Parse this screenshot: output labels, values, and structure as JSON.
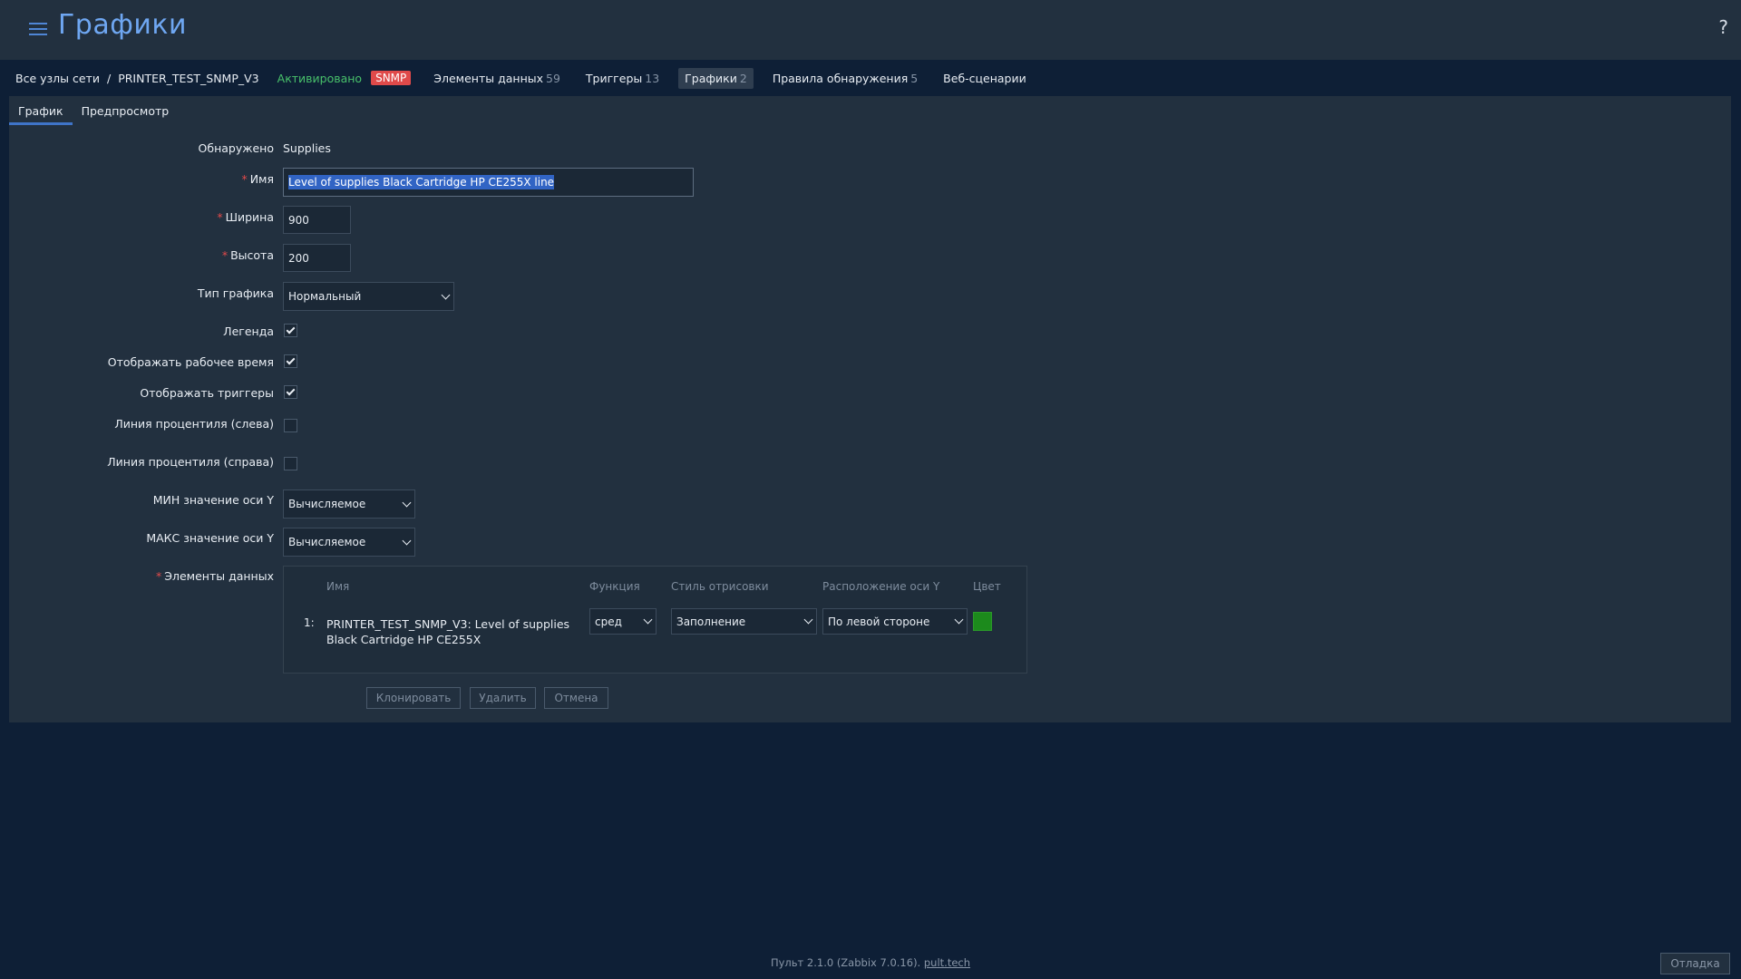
{
  "header": {
    "title": "Графики",
    "help": "?"
  },
  "hostnav": {
    "all_hosts": "Все узлы сети",
    "separator": "/",
    "host": "PRINTER_TEST_SNMP_V3",
    "status": "Активировано",
    "badge": "SNMP",
    "links": [
      {
        "label": "Элементы данных",
        "count": "59"
      },
      {
        "label": "Триггеры",
        "count": "13"
      },
      {
        "label": "Графики",
        "count": "2"
      },
      {
        "label": "Правила обнаружения",
        "count": "5"
      },
      {
        "label": "Веб-сценарии",
        "count": ""
      }
    ]
  },
  "tabs": [
    "График",
    "Предпросмотр"
  ],
  "form": {
    "discovered_label": "Обнаружено",
    "discovered_value": "Supplies",
    "name_label": "Имя",
    "name_value": "Level of supplies Black Cartridge HP CE255X  line",
    "width_label": "Ширина",
    "width_value": "900",
    "height_label": "Высота",
    "height_value": "200",
    "graph_type_label": "Тип графика",
    "graph_type_value": "Нормальный",
    "legend_label": "Легенда",
    "legend_checked": true,
    "worktime_label": "Отображать рабочее время",
    "worktime_checked": true,
    "triggers_label": "Отображать триггеры",
    "triggers_checked": true,
    "percentile_left_label": "Линия процентиля (слева)",
    "percentile_left_checked": false,
    "percentile_right_label": "Линия процентиля (справа)",
    "percentile_right_checked": false,
    "ymin_label": "МИН значение оси Y",
    "ymin_value": "Вычисляемое",
    "ymax_label": "МАКС значение оси Y",
    "ymax_value": "Вычисляемое",
    "items_label": "Элементы данных"
  },
  "items_table": {
    "headers": [
      "Имя",
      "Функция",
      "Стиль отрисовки",
      "Расположение оси Y",
      "Цвет"
    ],
    "rows": [
      {
        "num": "1:",
        "name": "PRINTER_TEST_SNMP_V3: Level of supplies Black Cartridge HP CE255X",
        "function": "сред",
        "style": "Заполнение",
        "axis": "По левой стороне",
        "color": "#1c8a1c"
      }
    ]
  },
  "buttons": {
    "clone": "Клонировать",
    "delete": "Удалить",
    "cancel": "Отмена"
  },
  "footer": {
    "text": "Пульт 2.1.0 (Zabbix 7.0.16).",
    "link": "pult.tech",
    "debug": "Отладка"
  }
}
